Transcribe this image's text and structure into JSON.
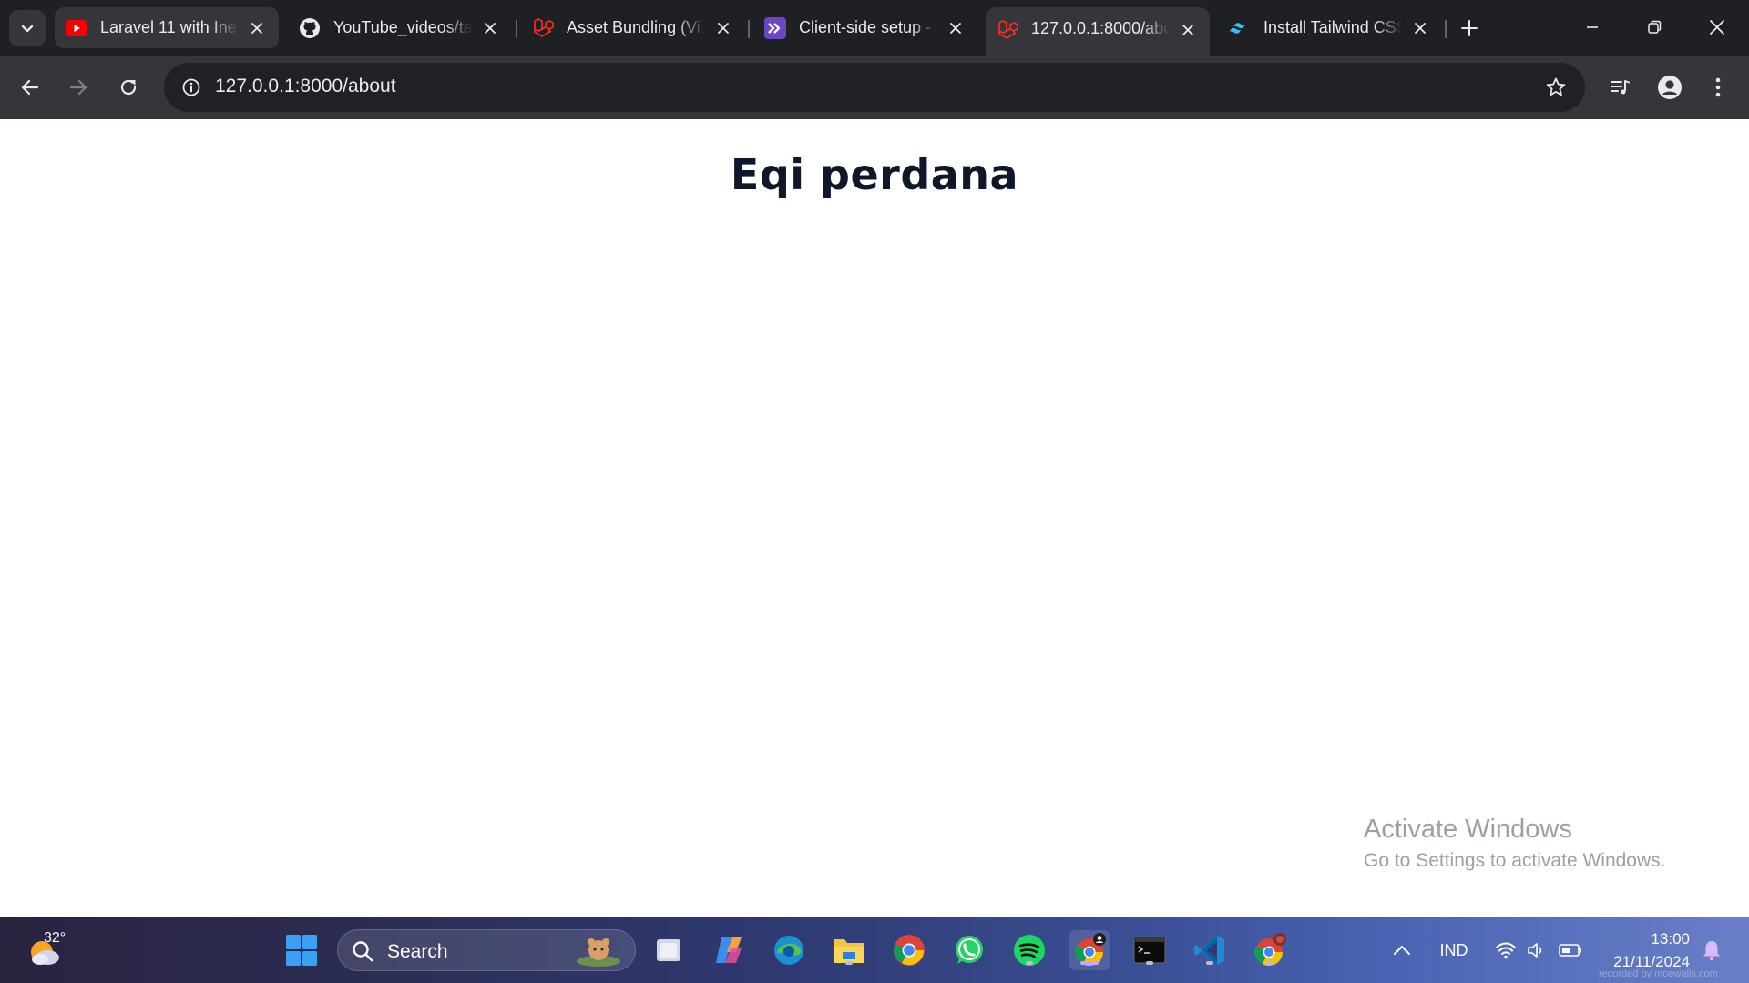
{
  "browser": {
    "tabs": [
      {
        "title": "Laravel 11 with Ine",
        "icon": "youtube-icon"
      },
      {
        "title": "YouTube_videos/ta",
        "icon": "github-icon"
      },
      {
        "title": "Asset Bundling (Vi",
        "icon": "laravel-icon"
      },
      {
        "title": "Client-side setup -",
        "icon": "inertia-icon"
      },
      {
        "title": "127.0.0.1:8000/abo",
        "icon": "laravel-icon",
        "active": true
      },
      {
        "title": "Install Tailwind CSS",
        "icon": "tailwind-icon"
      }
    ],
    "address": {
      "host": "127.0.0.1",
      "path": ":8000/about"
    },
    "colors": {
      "tabstrip": "#1f2023",
      "toolbar": "#35363a",
      "omnibox": "#202124",
      "youtube_red": "#ff0000",
      "laravel_red": "#ff2d20",
      "inertia_purple": "#6b46c1",
      "tailwind_cyan": "#38bdf8"
    }
  },
  "page": {
    "heading": "Eqi perdana",
    "heading_color": "#0f172a"
  },
  "watermark": {
    "line1": "Activate Windows",
    "line2": "Go to Settings to activate Windows."
  },
  "taskbar": {
    "weather_temp": "32°",
    "search_placeholder": "Search",
    "apps": [
      "windows-start-icon",
      "task-view-icon",
      "copilot-icon",
      "edge-icon",
      "file-explorer-icon",
      "chrome-icon",
      "whatsapp-icon",
      "spotify-icon",
      "chrome-profile-icon",
      "terminal-icon",
      "vscode-icon",
      "chrome-alt-icon"
    ],
    "language": "IND",
    "time": "13:00",
    "date": "21/11/2024",
    "recorder_note": "recorded by moewalls.com"
  }
}
